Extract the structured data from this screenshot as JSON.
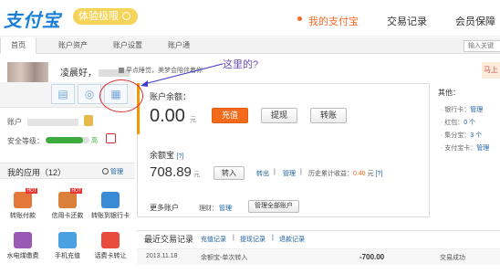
{
  "header": {
    "logo": "支付宝",
    "tagline": "体验极限",
    "nav": [
      "我的支付宝",
      "交易记录",
      "会员保障"
    ]
  },
  "subnav": {
    "tabs": [
      "首页",
      "账户资产",
      "账户设置",
      "账户通"
    ],
    "search_placeholder": "输入关键"
  },
  "user": {
    "greeting": "凌晨好，",
    "tip": "早点睡觉，美梦会陪伴着你",
    "account_label": "账户",
    "security_label": "安全等级：",
    "security_level": "高",
    "security_fraction": 0.85
  },
  "annotation": "这里的?",
  "apps": {
    "title": "我的应用（12）",
    "manage": "管理",
    "items": [
      {
        "label": "转账付款",
        "hot": "HOT",
        "color": "#e3793b"
      },
      {
        "label": "信用卡还款",
        "hot": "HOT",
        "color": "#d9803a"
      },
      {
        "label": "转账到银行卡",
        "hot": "",
        "color": "#3a8bd6"
      },
      {
        "label": "水电煤缴费",
        "hot": "",
        "color": "#9b59b6"
      },
      {
        "label": "手机充值",
        "hot": "",
        "color": "#4aa0e0"
      },
      {
        "label": "话费卡转让",
        "hot": "",
        "color": "#e74c3c"
      }
    ]
  },
  "balance": {
    "label": "账户余额：",
    "value": "0.00",
    "unit": "元",
    "buttons": [
      "充值",
      "提现",
      "转账"
    ]
  },
  "yeb": {
    "label": "余额宝",
    "help": "[?]",
    "value": "708.89",
    "unit": "元",
    "transfer_in": "转入",
    "transfer_out": "转出",
    "manage": "管理",
    "history_label": "历史累计收益：",
    "history_value": "0.46",
    "history_unit": "元",
    "help2": "[?]"
  },
  "more": {
    "label": "更多账户",
    "jifen_label": "理财：",
    "jifen_manage": "管理",
    "manage_all": "管理全部账户"
  },
  "others": {
    "title": "其他：",
    "items": [
      {
        "label": "银行卡：",
        "link": "管理"
      },
      {
        "label": "红包：",
        "link": "0 个"
      },
      {
        "label": "集分宝：",
        "link": "3 个"
      },
      {
        "label": "支付宝卡：",
        "link": "管理"
      }
    ]
  },
  "promo": "马上",
  "recent": {
    "title": "最近交易记录",
    "links": [
      "充值记录",
      "提现记录",
      "退款记录"
    ],
    "rows": [
      {
        "date": "2013.11.18",
        "desc": "余额宝-单次转入",
        "amount": "-700.00",
        "status": "交易成功"
      }
    ]
  }
}
